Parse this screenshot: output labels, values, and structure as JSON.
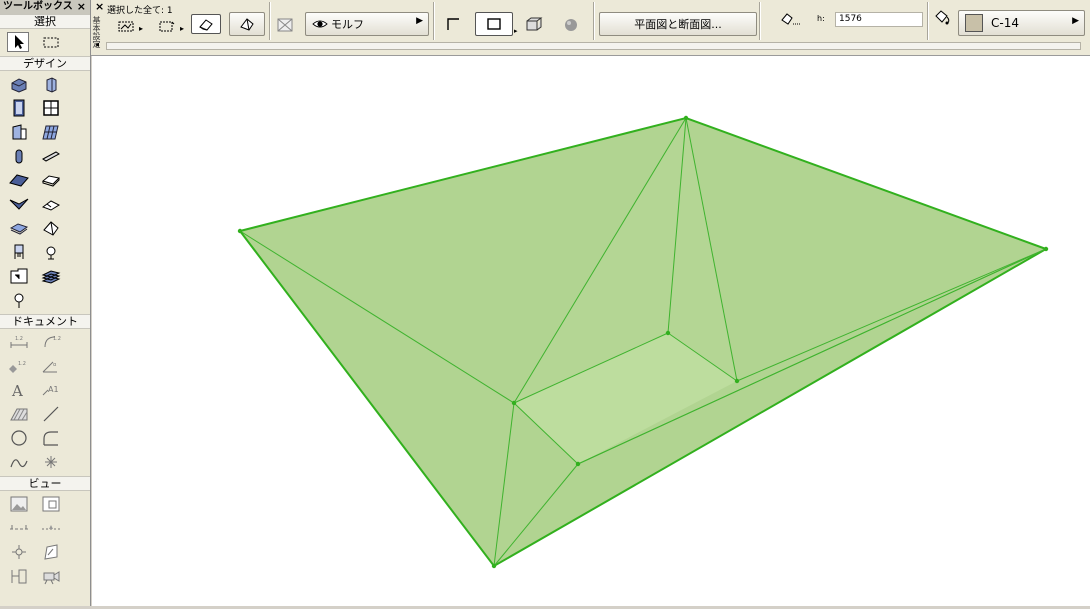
{
  "toolbox": {
    "title": "ツールボックス",
    "close": "×",
    "sections": {
      "select": "選択",
      "design": "デザイン",
      "document": "ドキュメント",
      "view": "ビュー"
    }
  },
  "infobar": {
    "close": "×",
    "vertical_tab": "基本設定",
    "selection_status": "選択した全て: 1",
    "morph_label": "モルフ",
    "section_button": "平面図と断面図...",
    "h_label": "h:",
    "h_value": "1576",
    "material_value": "C-14",
    "material_swatch": "#c8c0a8"
  },
  "canvas": {
    "morph_fill": "#a9cf85",
    "morph_edge": "#3fb32f",
    "selection_color": "#32b01e"
  }
}
